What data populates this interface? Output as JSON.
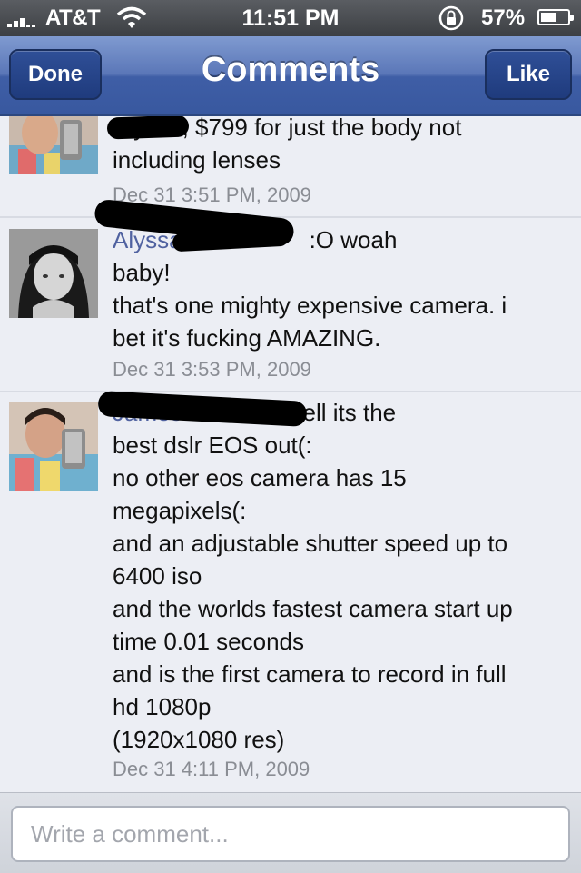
{
  "status_bar": {
    "carrier": "AT&T",
    "time": "11:51 PM",
    "battery_percent": "57%",
    "battery_level": 0.57,
    "icons": [
      "signal-icon",
      "wifi-icon",
      "rotation-lock-icon",
      "battery-icon"
    ]
  },
  "nav": {
    "done_label": "Done",
    "title": "Comments",
    "like_label": "Like"
  },
  "comments": [
    {
      "author": "",
      "lines": [
        "Alyssa, $799 for just the body not",
        "including lenses"
      ],
      "timestamp": "Dec 31 3:51 PM, 2009"
    },
    {
      "author": "Alyssa",
      "lines": [
        ":O woah",
        "baby!",
        "that's one mighty expensive camera. i",
        "bet it's fucking AMAZING."
      ],
      "timestamp": "Dec 31 3:53 PM, 2009"
    },
    {
      "author": "James Osborne",
      "lines": [
        "well its the",
        "best dslr EOS out(:",
        "no other eos camera has 15",
        "megapixels(:",
        "and an adjustable shutter speed up to",
        "6400 iso",
        "and the worlds fastest camera start up",
        "time 0.01 seconds",
        "and is the first camera to record in full",
        "hd 1080p",
        "(1920x1080 res)"
      ],
      "timestamp": "Dec 31 4:11 PM, 2009"
    }
  ],
  "composer": {
    "placeholder": "Write a comment..."
  },
  "colors": {
    "nav_blue": "#4a67ad",
    "link_author": "#5062a0",
    "timestamp_gray": "#8a8d94",
    "background": "#eceef4"
  }
}
